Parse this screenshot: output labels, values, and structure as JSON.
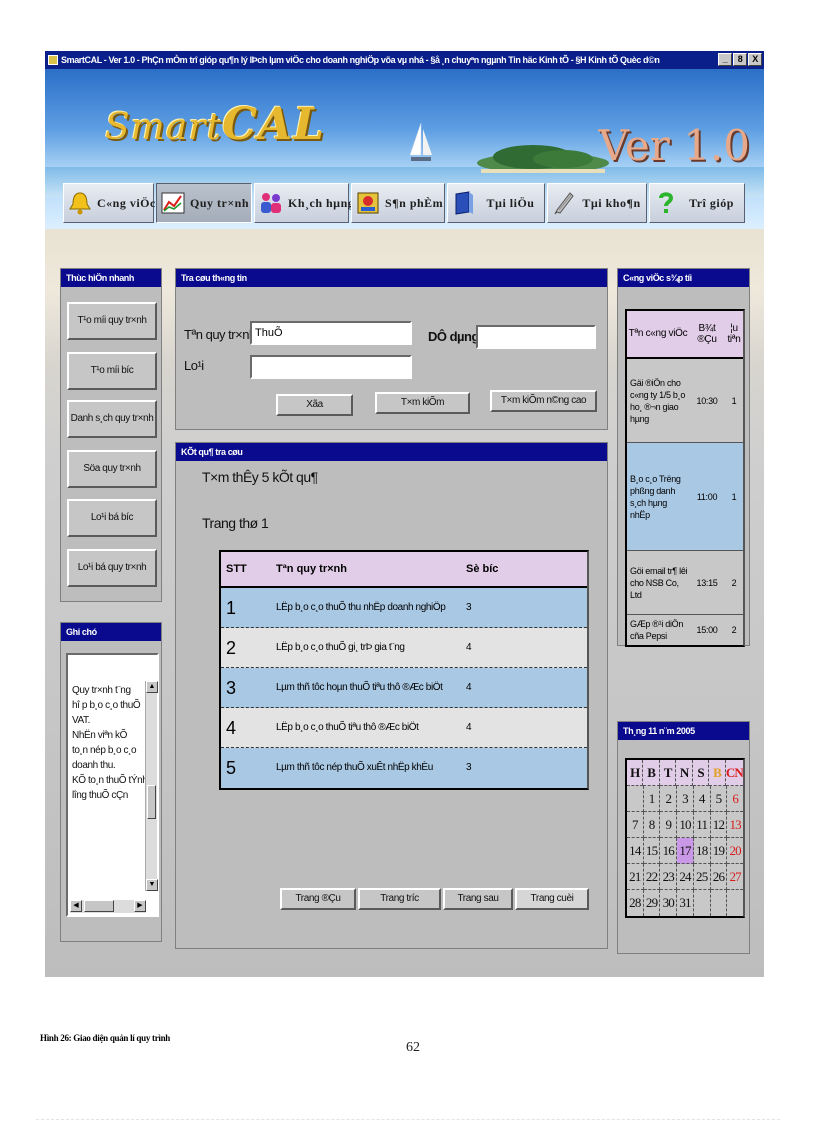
{
  "window": {
    "title": "SmartCAL - Ver 1.0 - PhÇn mÒm trî gióp qu¶n lý lÞch lµm viÖc cho doanh nghiÖp võa vµ nhá - §å ¸n chuyªn ngµnh Tin häc Kinh tÕ - §H Kinh tÕ Quèc d©n",
    "min": "_",
    "max": "8",
    "close": "X"
  },
  "banner": {
    "logo_left": "Smart",
    "logo_right": "CAL",
    "version": "Ver 1.0"
  },
  "toolbar": [
    {
      "label": "C«ng viÖc",
      "icon": "bell-icon"
    },
    {
      "label": "Quy tr×nh",
      "icon": "chart-icon"
    },
    {
      "label": "Kh¸ch hµng",
      "icon": "people-icon"
    },
    {
      "label": "S¶n phÈm",
      "icon": "product-icon"
    },
    {
      "label": "Tµi liÖu",
      "icon": "book-icon"
    },
    {
      "label": "Tµi kho¶n",
      "icon": "pencil-icon"
    },
    {
      "label": "Trî gióp",
      "icon": "question-icon"
    }
  ],
  "quick_panel": {
    "title": "Thùc hiÖn nhanh",
    "buttons": [
      "T¹o míi quy tr×nh",
      "T¹o míi b­íc",
      "Danh s¸ch quy tr×nh",
      "Söa quy tr×nh",
      "Lo¹i bá b­íc",
      "Lo¹i bá quy tr×nh"
    ]
  },
  "notes_panel": {
    "title": "Ghi chó",
    "text": "Quy tr×nh t¨ng\nhî p b¸o c¸o thuÕ\nVAT.\nNhËn viªn kÕ\nto¸n nép b¸o c¸o\ndoanh thu.\nKÕ to¸n thuÕ tÝnh\nl­îng thuÕ cÇn"
  },
  "search_panel": {
    "title": "Tra cøu th«ng tin",
    "name_label": "Tªn quy tr×nh",
    "name_value": "ThuÕ",
    "date_label": "DÔ dµng",
    "date_value": "",
    "type_label": "Lo¹i",
    "type_value": "",
    "btn_clear": "Xãa",
    "btn_search": "T×m kiÕm",
    "btn_advanced": "T×m kiÕm n©ng cao"
  },
  "results_panel": {
    "title": "KÕt qu¶ tra cøu",
    "found": "T×m thÊy 5 kÕt qu¶",
    "page": "Trang thø 1",
    "columns": [
      "STT",
      "Tªn quy tr×nh",
      "Sè b­íc"
    ],
    "rows": [
      {
        "stt": "1",
        "name": "LËp b¸o c¸o thuÕ thu nhËp doanh nghiÖp",
        "steps": "3"
      },
      {
        "stt": "2",
        "name": "LËp b¸o c¸o thuÕ gi¸ trÞ gia t¨ng",
        "steps": "4"
      },
      {
        "stt": "3",
        "name": "Lµm thñ tôc hoµn thuÕ tiªu thô ®Æc biÖt",
        "steps": "4"
      },
      {
        "stt": "4",
        "name": "LËp b¸o c¸o thuÕ tiªu thô ®Æc biÖt",
        "steps": "4"
      },
      {
        "stt": "5",
        "name": "Lµm thñ tôc nép thuÕ xuÊt nhËp khÈu",
        "steps": "3"
      }
    ],
    "pager": [
      "Trang ®Çu",
      "Trang tr­íc",
      "Trang sau",
      "Trang cuèi"
    ]
  },
  "tasks_panel": {
    "title": "C«ng viÖc s¾p tíi",
    "columns": [
      "Tªn c«ng viÖc",
      "B¾t ®Çu",
      "¦u tiªn"
    ],
    "rows": [
      {
        "name": "Gäi ®iÖn cho c«ng ty 1/5 b¸o ho¸ ®¬n giao hµng",
        "start": "10:30",
        "priority": "1"
      },
      {
        "name": "B¸o c¸o Tr­ëng phßng danh s¸ch hµng nhËp",
        "start": "11:00",
        "priority": "1"
      },
      {
        "name": "Göi email tr¶ lêi cho NSB Co, Ltd",
        "start": "13:15",
        "priority": "2"
      },
      {
        "name": "GÆp ®¹i diÖn cña Pepsi",
        "start": "15:00",
        "priority": "2"
      }
    ]
  },
  "calendar": {
    "title": "Th¸ng 11 n¨m 2005",
    "headers": [
      "H",
      "B",
      "T",
      "N",
      "S",
      "B",
      "CN"
    ],
    "weeks": [
      [
        "",
        "1",
        "2",
        "3",
        "4",
        "5",
        "6"
      ],
      [
        "7",
        "8",
        "9",
        "10",
        "11",
        "12",
        "13"
      ],
      [
        "14",
        "15",
        "16",
        "17",
        "18",
        "19",
        "20"
      ],
      [
        "21",
        "22",
        "23",
        "24",
        "25",
        "26",
        "27"
      ],
      [
        "28",
        "29",
        "30",
        "31",
        "",
        "",
        ""
      ]
    ],
    "today": "17",
    "colors": {
      "sunday": "#d81b1b",
      "saturday": "#e2a020",
      "today_bg": "#c998e6"
    }
  },
  "caption": "Hình 26: Giao diện quản lí quy trình",
  "page_number": "62"
}
